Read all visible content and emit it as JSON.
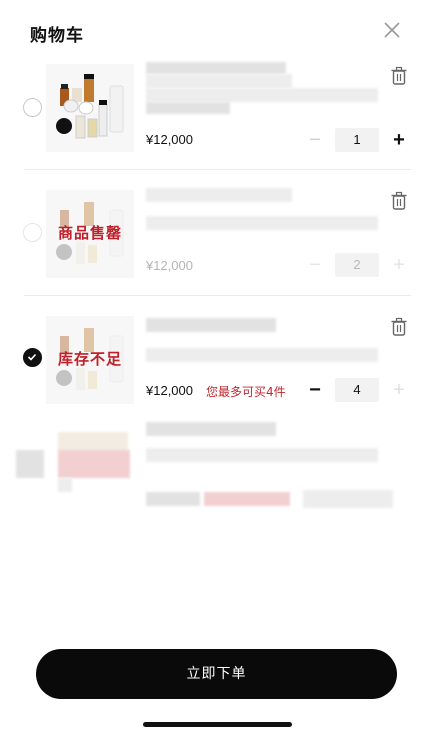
{
  "header": {
    "title": "购物车",
    "close_icon": "close-icon"
  },
  "items": [
    {
      "state": "available",
      "selected": false,
      "price": "¥12,000",
      "quantity": "1",
      "overlay": "",
      "limit_text": ""
    },
    {
      "state": "sold_out",
      "selected": false,
      "price": "¥12,000",
      "quantity": "2",
      "overlay": "商品售罄",
      "limit_text": ""
    },
    {
      "state": "insufficient_stock",
      "selected": true,
      "price": "¥12,000",
      "quantity": "4",
      "overlay": "库存不足",
      "limit_text": "您最多可买4件"
    }
  ],
  "checkout": {
    "label": "立即下单"
  },
  "colors": {
    "accent": "#0a0a0a",
    "warning": "#c0262f",
    "divider": "#ececec"
  }
}
